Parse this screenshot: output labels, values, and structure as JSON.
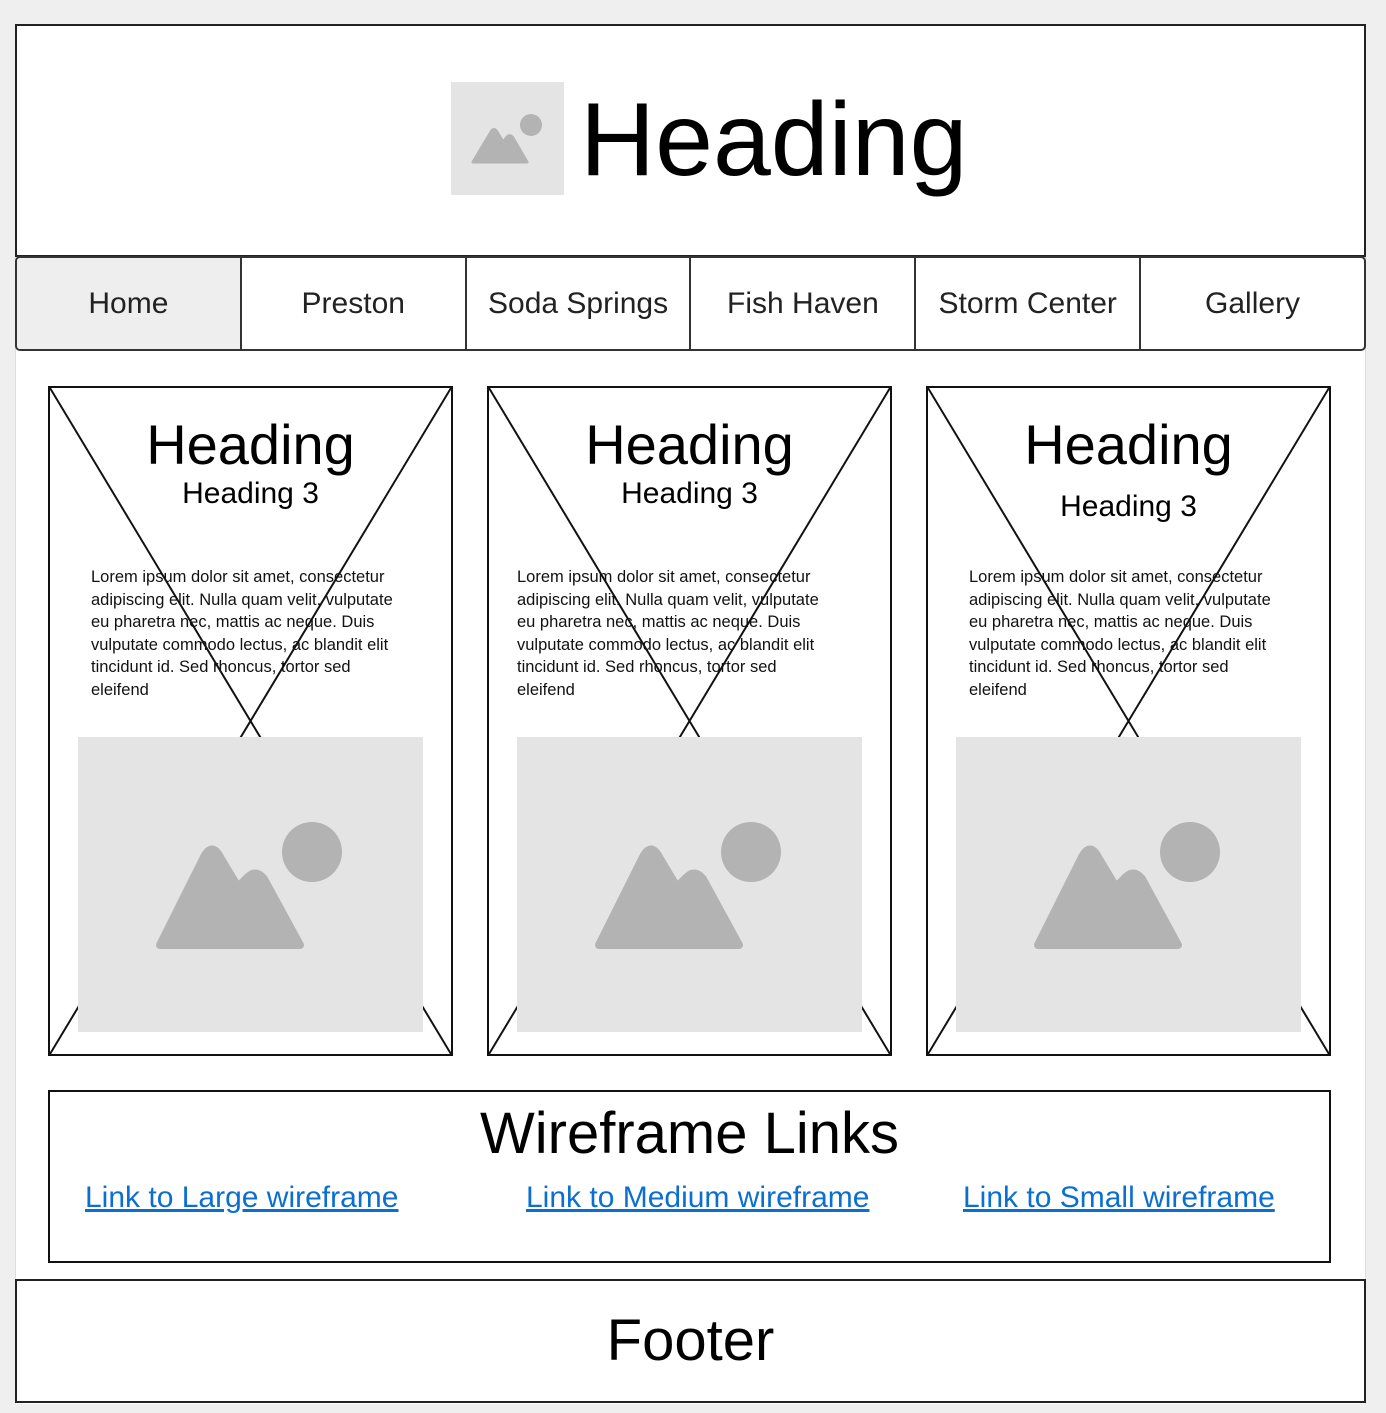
{
  "header": {
    "title": "Heading",
    "logo_icon": "image-placeholder-icon"
  },
  "nav": {
    "items": [
      {
        "label": "Home",
        "active": true
      },
      {
        "label": "Preston",
        "active": false
      },
      {
        "label": "Soda Springs",
        "active": false
      },
      {
        "label": "Fish Haven",
        "active": false
      },
      {
        "label": "Storm Center",
        "active": false
      },
      {
        "label": "Gallery",
        "active": false
      }
    ]
  },
  "cards": [
    {
      "heading": "Heading",
      "subheading": "Heading 3",
      "text": "Lorem ipsum dolor sit amet, consectetur adipiscing elit. Nulla quam velit, vulputate eu pharetra nec, mattis ac neque. Duis vulputate commodo lectus, ac blandit elit tincidunt id. Sed rhoncus, tortor sed eleifend",
      "image_icon": "image-placeholder-icon"
    },
    {
      "heading": "Heading",
      "subheading": "Heading 3",
      "text": "Lorem ipsum dolor sit amet, consectetur adipiscing elit. Nulla quam velit, vulputate eu pharetra nec, mattis ac neque. Duis vulputate commodo lectus, ac blandit elit tincidunt id. Sed rhoncus, tortor sed eleifend",
      "image_icon": "image-placeholder-icon"
    },
    {
      "heading": "Heading",
      "subheading": "Heading 3",
      "text": "Lorem ipsum dolor sit amet, consectetur adipiscing elit. Nulla quam velit, vulputate eu pharetra nec, mattis ac neque. Duis vulputate commodo lectus, ac blandit elit tincidunt id. Sed rhoncus, tortor sed eleifend",
      "image_icon": "image-placeholder-icon"
    }
  ],
  "links_section": {
    "title": "Wireframe Links",
    "links": [
      {
        "label": "Link to Large wireframe"
      },
      {
        "label": "Link to Medium wireframe"
      },
      {
        "label": "Link to Small wireframe"
      }
    ]
  },
  "footer": {
    "text": "Footer"
  },
  "colors": {
    "link": "#0b6fd1",
    "placeholder_bg": "#e4e4e4",
    "placeholder_shape": "#b3b3b3",
    "active_tab_bg": "#eeeeee"
  }
}
